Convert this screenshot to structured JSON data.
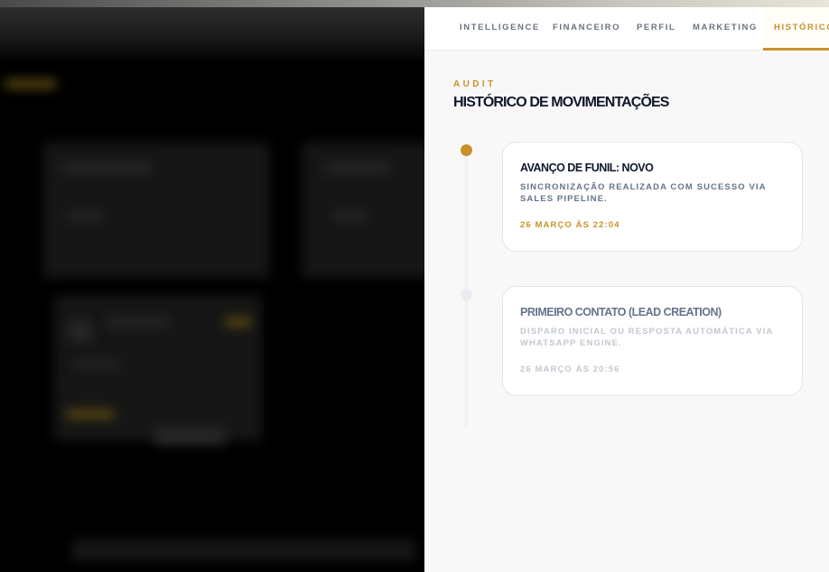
{
  "tabs": [
    {
      "label": "INTELLIGENCE",
      "active": false
    },
    {
      "label": "FINANCEIRO",
      "active": false
    },
    {
      "label": "PERFIL",
      "active": false
    },
    {
      "label": "MARKETING",
      "active": false
    },
    {
      "label": "HISTÓRICO",
      "active": true
    }
  ],
  "section": {
    "kicker": "AUDIT",
    "title": "HISTÓRICO DE MOVIMENTAÇÕES"
  },
  "timeline": [
    {
      "title": "AVANÇO DE FUNIL: NOVO",
      "description": "SINCRONIZAÇÃO REALIZADA COM SUCESSO VIA SALES PIPELINE.",
      "time": "26 MARÇO ÀS 22:04",
      "active": true
    },
    {
      "title": "PRIMEIRO CONTATO (LEAD CREATION)",
      "description": "DISPARO INICIAL OU RESPOSTA AUTOMÁTICA VIA WHATSAPP ENGINE.",
      "time": "26 MARÇO ÀS 20:56",
      "active": false
    }
  ],
  "colors": {
    "accent": "#c8922a",
    "drawer_bg": "#f8f8f8",
    "title": "#0f172a",
    "muted": "#64748b",
    "backdrop": "#000000"
  }
}
